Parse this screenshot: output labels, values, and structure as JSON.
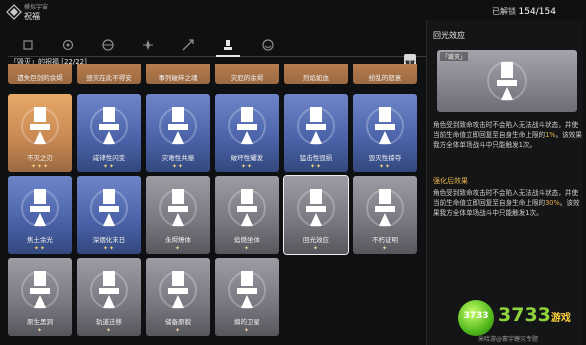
{
  "header": {
    "subtitle": "模拟宇宙",
    "title": "祝福",
    "unlock_label": "已解锁",
    "unlock_count": "154/154"
  },
  "tabs": [
    {
      "icon": "preservation-path-icon"
    },
    {
      "icon": "remembrance-path-icon"
    },
    {
      "icon": "nihility-path-icon"
    },
    {
      "icon": "abundance-path-icon"
    },
    {
      "icon": "hunt-path-icon"
    },
    {
      "icon": "destruction-path-icon",
      "active": true
    },
    {
      "icon": "elation-path-icon"
    }
  ],
  "section": {
    "title": "「毁灭」的祝福 [22/22]"
  },
  "top_row_labels": [
    "",
    "遗失巨剑的余烬",
    "毁灭在此不得安",
    "事列破碎之魂",
    "灾厄的余烬",
    "烈焰如血",
    "纷乱的怒意"
  ],
  "cards": [
    {
      "name": "不灭之刃",
      "stars": "✦✦✦",
      "style": "orange"
    },
    {
      "name": "咸律性闪变",
      "stars": "✦✦",
      "style": "blue"
    },
    {
      "name": "灾难性共振",
      "stars": "✦✦",
      "style": "blue"
    },
    {
      "name": "破坏性耀发",
      "stars": "✦✦",
      "style": "blue"
    },
    {
      "name": "猛击性毁损",
      "stars": "✦✦",
      "style": "blue"
    },
    {
      "name": "毁灭性掠夺",
      "stars": "✦✦",
      "style": "blue"
    },
    {
      "name": "焦土余光",
      "stars": "✦✦",
      "style": "blue"
    },
    {
      "name": "深烟化末日",
      "stars": "✦✦",
      "style": "blue"
    },
    {
      "name": "永烬燎体",
      "stars": "✦",
      "style": "gray"
    },
    {
      "name": "焰燃坐体",
      "stars": "✦",
      "style": "gray"
    },
    {
      "name": "回光效应",
      "stars": "✦",
      "style": "gray",
      "selected": true
    },
    {
      "name": "不朽证明",
      "stars": "✦",
      "style": "gray"
    },
    {
      "name": "原生黑洞",
      "stars": "✦",
      "style": "gray"
    },
    {
      "name": "轨道迁移",
      "stars": "✦",
      "style": "gray"
    },
    {
      "name": "储备原貌",
      "stars": "✦",
      "style": "gray"
    },
    {
      "name": "熵的卫星",
      "stars": "✦",
      "style": "gray"
    }
  ],
  "detail": {
    "title": "回光效应",
    "path_tag": "「毁灭」",
    "desc_1a": "角色受到致命攻击时不会陷入无法战斗状态，并使当前生命值立即回复至自身生命上限的",
    "desc_1b": "1%",
    "desc_1c": "。该效果我方全体单场战斗中只能触发1次。",
    "enhanced_head": "强化后效果",
    "desc_2a": "角色受到致命攻击时不会陷入无法战斗状态，并使当前生命值立即回复至自身生命上限的",
    "desc_2b": "30%",
    "desc_2c": "。该效果我方全体单场战斗中只能触发1次。"
  },
  "watermark": {
    "circle": "3733",
    "big": "3733",
    "small": "游戏",
    "bottom": "米哈游@寰宇蝗灾专题"
  }
}
